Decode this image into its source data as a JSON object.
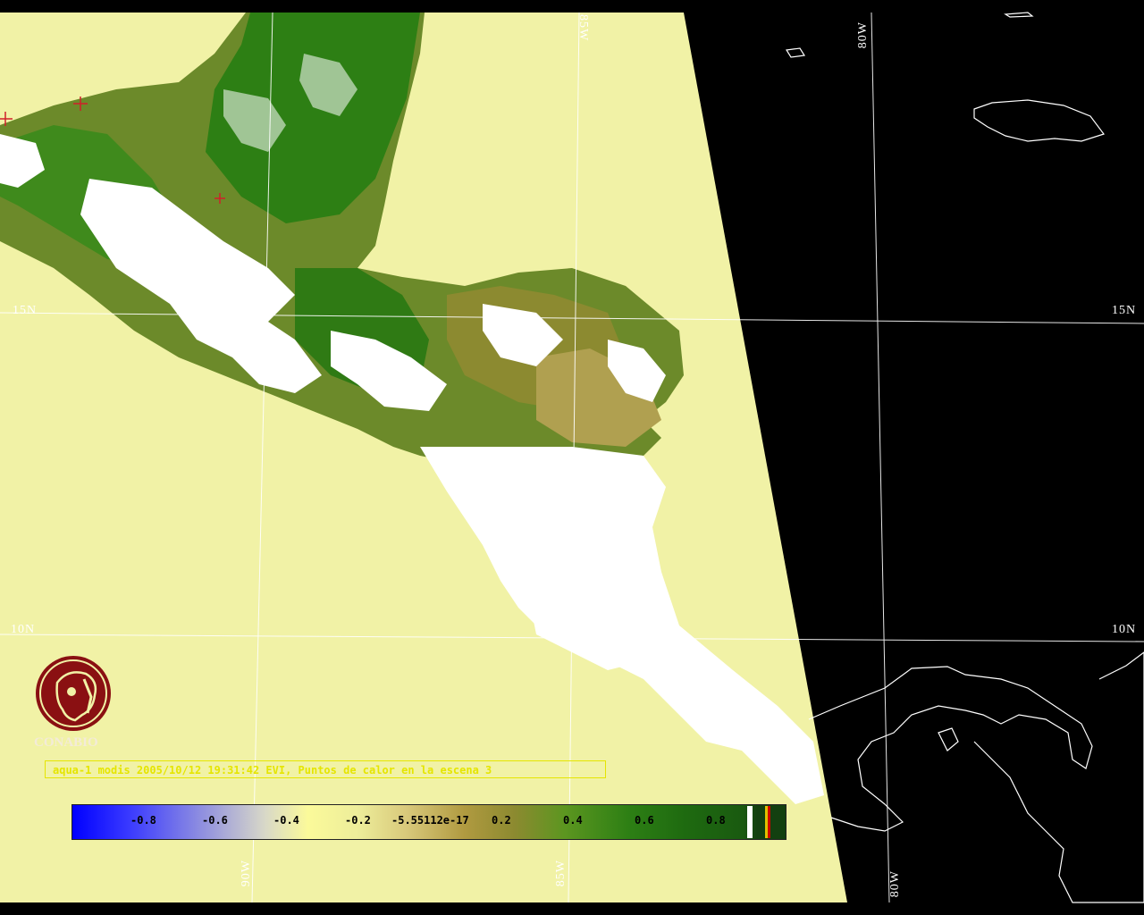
{
  "map": {
    "graticule": {
      "lat_labels": [
        "15N",
        "10N"
      ],
      "lon_labels": [
        "90W",
        "85W",
        "80W"
      ]
    },
    "colors": {
      "ocean_scene": "#f1f2a6",
      "outside_scene": "#000000",
      "cloud": "#ffffff",
      "vegetation_dense": "#2d7f14",
      "vegetation_sparse": "#8c8a30",
      "grid": "#ffffff"
    }
  },
  "logo": {
    "name": "CONABIO",
    "icon": "conabio-logo-icon"
  },
  "caption": "aqua-1 modis 2005/10/12 19:31:42 EVI, Puntos de calor en la escena 3",
  "colorbar": {
    "ticks": [
      "-0.8",
      "-0.6",
      "-0.4",
      "-0.2",
      "-5.55112e-17",
      "0.2",
      "0.4",
      "0.6",
      "0.8"
    ],
    "colors": {
      "min": "#0000ff",
      "mid": "#fbfa9a",
      "max": "#134010"
    }
  }
}
